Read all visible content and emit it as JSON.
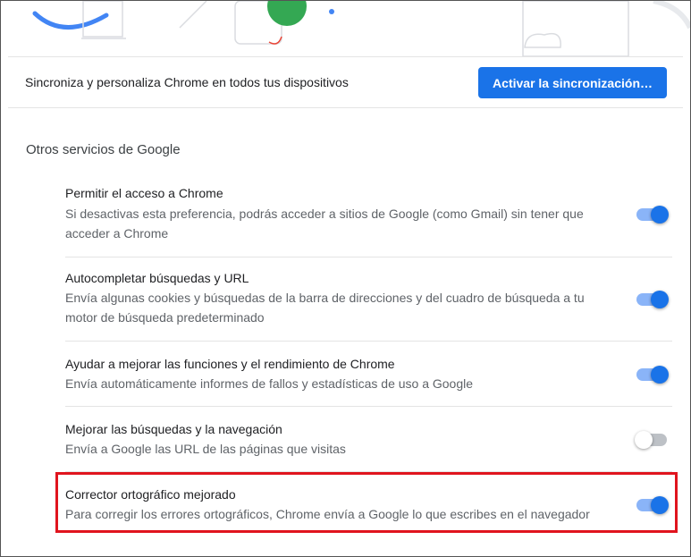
{
  "sync": {
    "description": "Sincroniza y personaliza Chrome en todos tus dispositivos",
    "button_label": "Activar la sincronización…"
  },
  "section_title": "Otros servicios de Google",
  "items": [
    {
      "title": "Permitir el acceso a Chrome",
      "description": "Si desactivas esta preferencia, podrás acceder a sitios de Google (como Gmail) sin tener que acceder a Chrome",
      "enabled": true
    },
    {
      "title": "Autocompletar búsquedas y URL",
      "description": "Envía algunas cookies y búsquedas de la barra de direcciones y del cuadro de búsqueda a tu motor de búsqueda predeterminado",
      "enabled": true
    },
    {
      "title": "Ayudar a mejorar las funciones y el rendimiento de Chrome",
      "description": "Envía automáticamente informes de fallos y estadísticas de uso a Google",
      "enabled": true
    },
    {
      "title": "Mejorar las búsquedas y la navegación",
      "description": "Envía a Google las URL de las páginas que visitas",
      "enabled": false
    },
    {
      "title": "Corrector ortográfico mejorado",
      "description": "Para corregir los errores ortográficos, Chrome envía a Google lo que escribes en el navegador",
      "enabled": true
    }
  ],
  "colors": {
    "accent": "#1a73e8",
    "toggle_track_on": "#8ab4f8",
    "toggle_track_off": "#bdc1c6",
    "highlight_border": "#e0141e"
  }
}
